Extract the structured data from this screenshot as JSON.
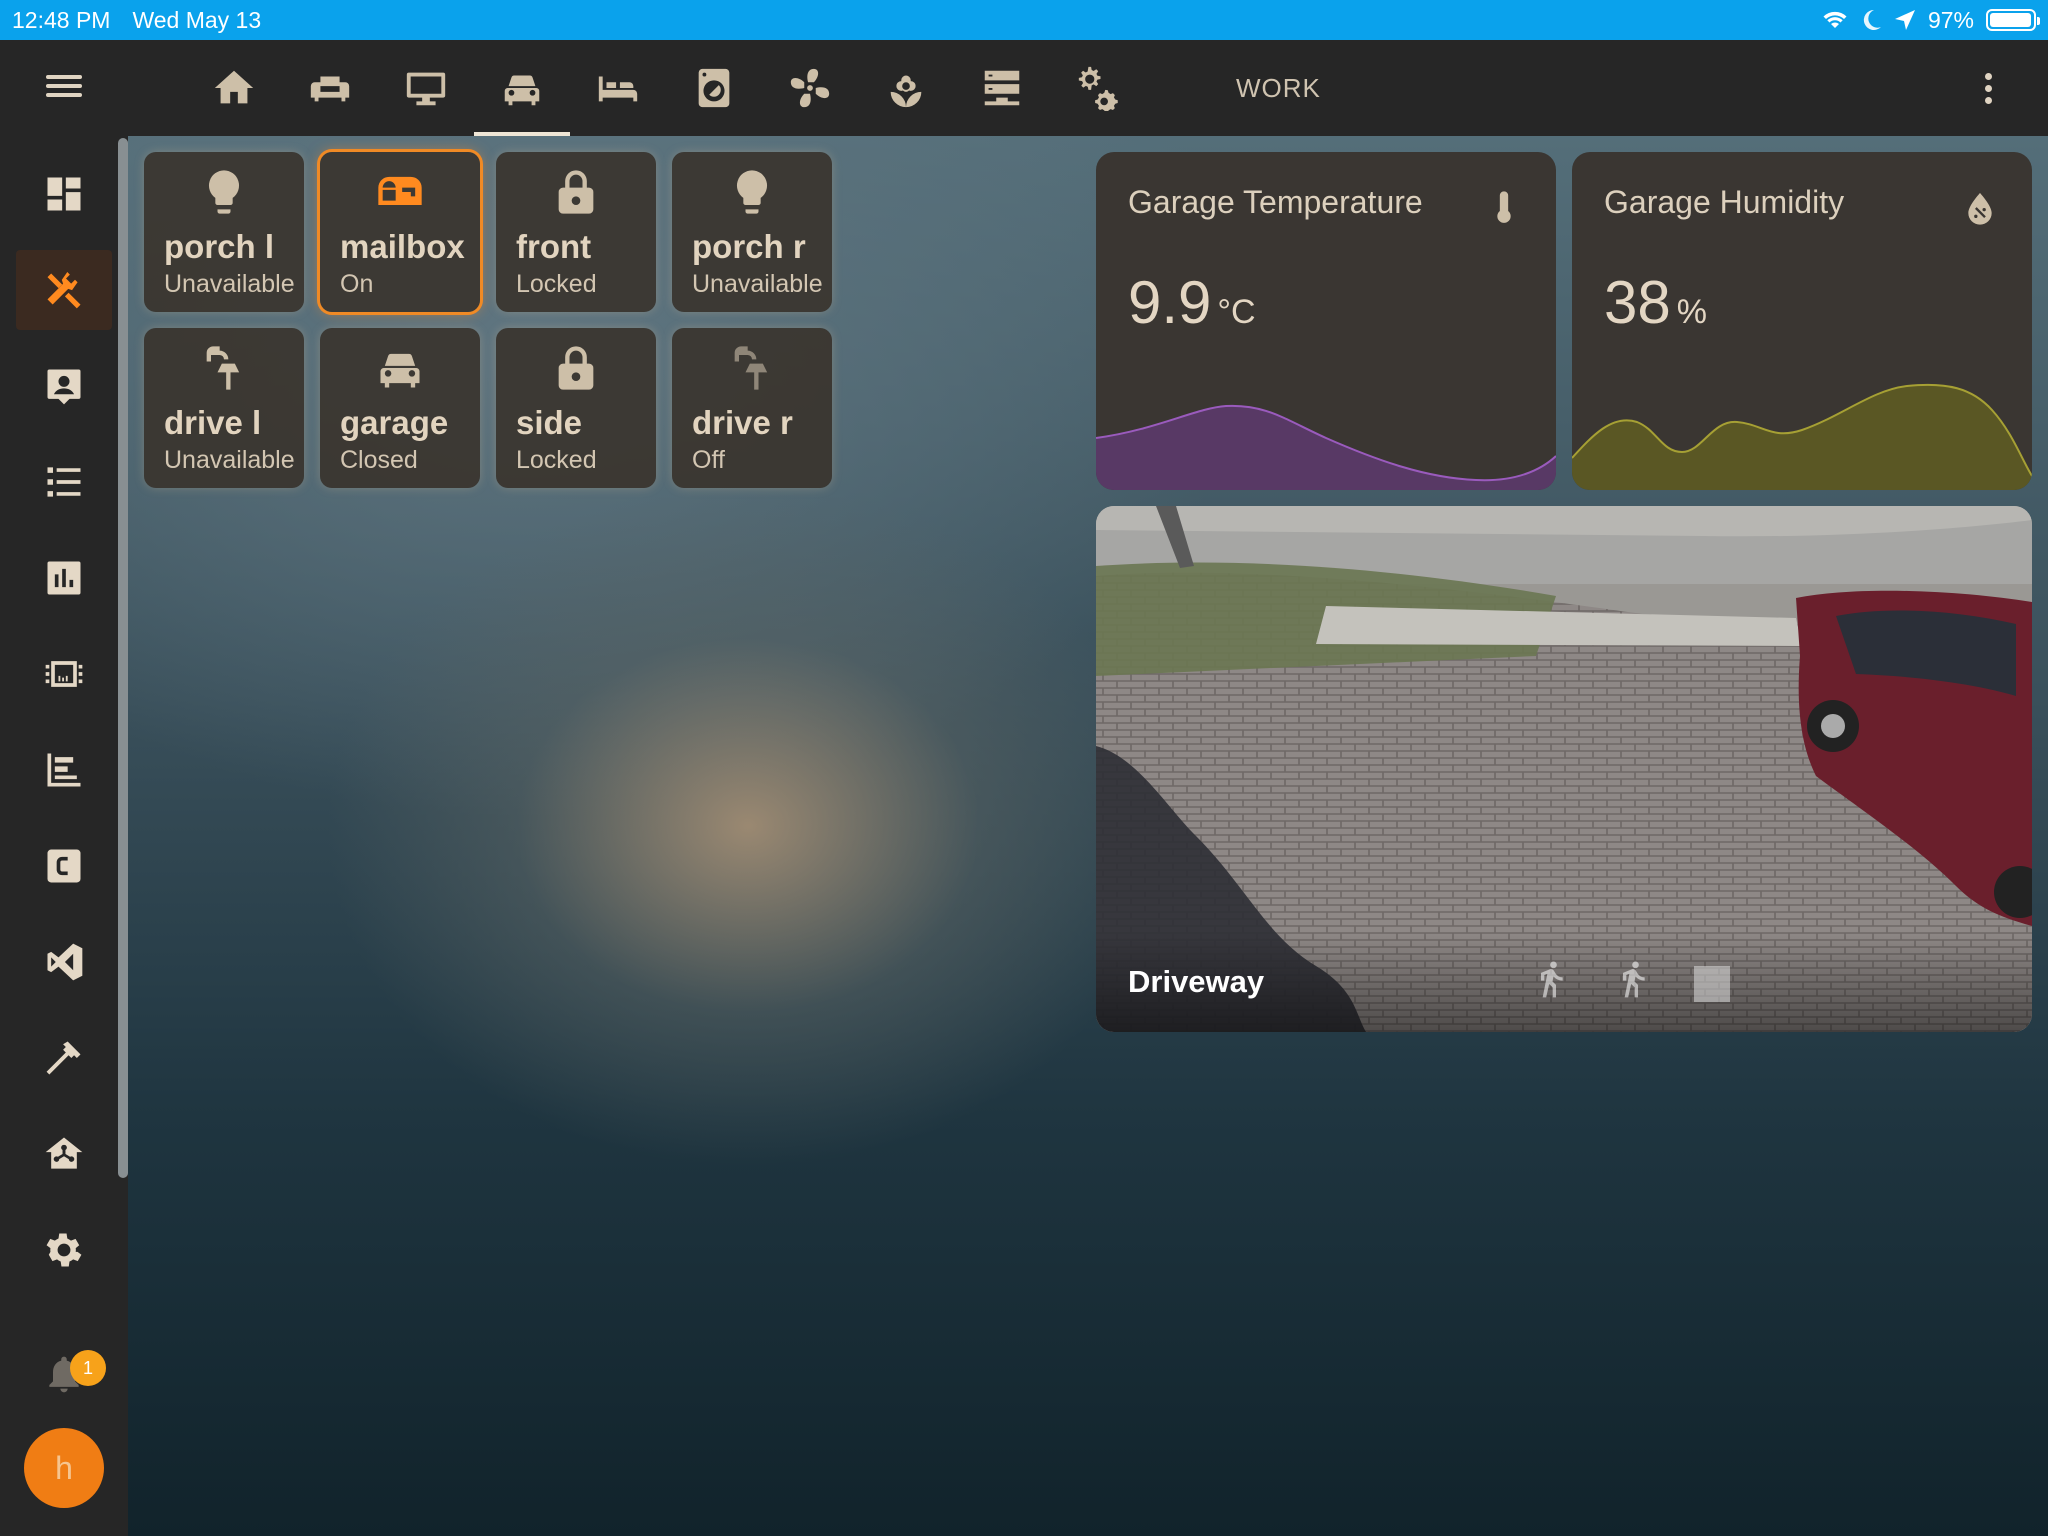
{
  "status_bar": {
    "time": "12:48 PM",
    "date": "Wed May 13",
    "battery": "97%",
    "battery_level": 0.97,
    "icons": [
      "wifi-icon",
      "moon-icon",
      "location-arrow-icon",
      "battery-icon"
    ]
  },
  "toolbar": {
    "menu_icon": "hamburger-menu-icon",
    "tabs": [
      {
        "icon": "home-icon"
      },
      {
        "icon": "sofa-icon"
      },
      {
        "icon": "monitor-icon"
      },
      {
        "icon": "car-icon",
        "active": true
      },
      {
        "icon": "bed-icon"
      },
      {
        "icon": "washing-machine-icon"
      },
      {
        "icon": "fan-icon"
      },
      {
        "icon": "flower-icon"
      },
      {
        "icon": "server-icon"
      },
      {
        "icon": "cogs-icon"
      }
    ],
    "work_label": "WORK",
    "more_icon": "dots-vertical-icon"
  },
  "sidebar": {
    "items": [
      {
        "icon": "dashboard-icon"
      },
      {
        "icon": "tools-icon",
        "active": true
      },
      {
        "icon": "account-box-icon"
      },
      {
        "icon": "list-icon"
      },
      {
        "icon": "chart-icon"
      },
      {
        "icon": "chip-icon"
      },
      {
        "icon": "timeline-icon"
      },
      {
        "icon": "letter-c-icon"
      },
      {
        "icon": "vscode-icon"
      },
      {
        "icon": "hammer-icon"
      },
      {
        "icon": "home-network-icon"
      },
      {
        "icon": "settings-icon"
      }
    ],
    "notification_count": "1",
    "avatar_letter": "h"
  },
  "tiles": [
    {
      "name": "porch l",
      "state": "Unavailable",
      "icon": "lightbulb-icon"
    },
    {
      "name": "mailbox",
      "state": "On",
      "icon": "mailbox-icon",
      "active": true
    },
    {
      "name": "front",
      "state": "Locked",
      "icon": "lock-icon"
    },
    {
      "name": "porch r",
      "state": "Unavailable",
      "icon": "lightbulb-icon"
    },
    {
      "name": "drive l",
      "state": "Unavailable",
      "icon": "outdoor-lamp-icon"
    },
    {
      "name": "garage",
      "state": "Closed",
      "icon": "car-icon"
    },
    {
      "name": "side",
      "state": "Locked",
      "icon": "lock-icon"
    },
    {
      "name": "drive r",
      "state": "Off",
      "icon": "outdoor-lamp-icon"
    }
  ],
  "sensors": {
    "temperature": {
      "title": "Garage Temperature",
      "value": "9.9",
      "unit": "°C",
      "icon": "thermometer-icon",
      "color": "#8a4fa8"
    },
    "humidity": {
      "title": "Garage Humidity",
      "value": "38",
      "unit": "%",
      "icon": "water-percent-icon",
      "color": "#8f8a2a"
    }
  },
  "camera": {
    "name": "Driveway",
    "controls": [
      "walk-icon",
      "walk-icon",
      "stop-icon"
    ]
  },
  "colors": {
    "accent": "#ff8a1f",
    "statusbar": "#0aa2ec",
    "chrome": "#262626"
  }
}
